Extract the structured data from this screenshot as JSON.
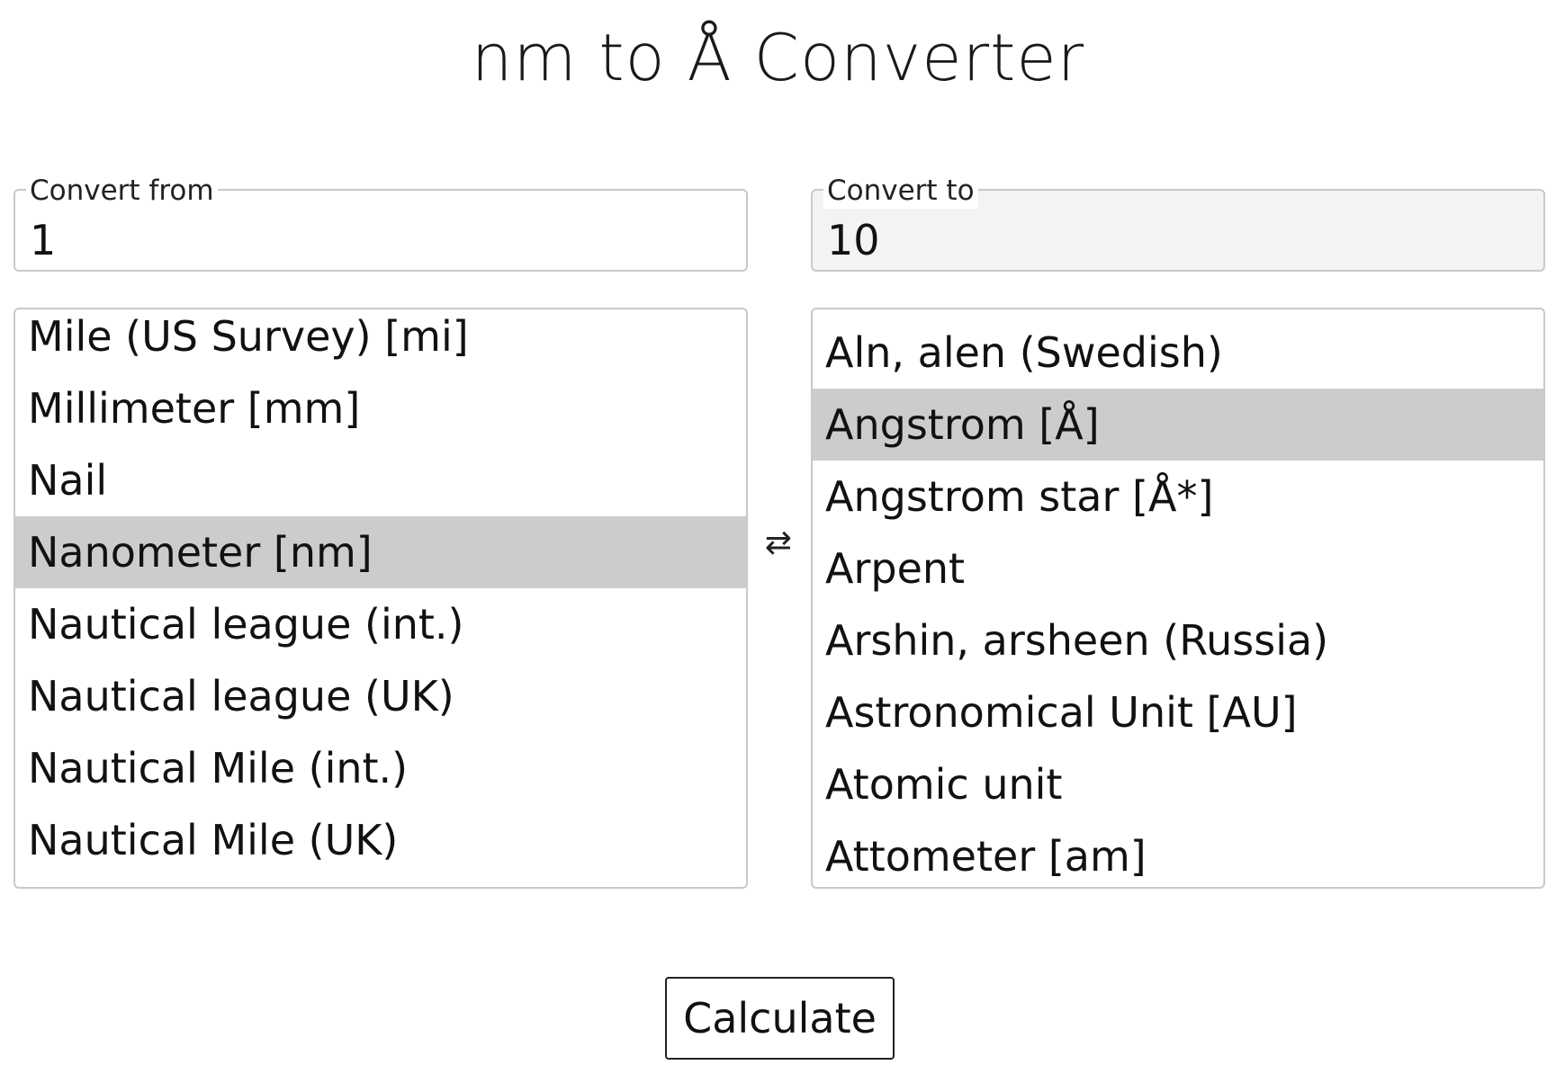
{
  "title": "nm to Å Converter",
  "from": {
    "label": "Convert from",
    "value": "1",
    "units": [
      "Mile (US Survey) [mi]",
      "Millimeter [mm]",
      "Nail",
      "Nanometer [nm]",
      "Nautical league (int.)",
      "Nautical league (UK)",
      "Nautical Mile (int.)",
      "Nautical Mile (UK)"
    ],
    "selected": "Nanometer [nm]"
  },
  "to": {
    "label": "Convert to",
    "value": "10",
    "units": [
      "Aln, alen (Swedish)",
      "Angstrom [Å]",
      "Angstrom star [Å*]",
      "Arpent",
      "Arshin, arsheen (Russia)",
      "Astronomical Unit [AU]",
      "Atomic unit",
      "Attometer [am]"
    ],
    "selected": "Angstrom [Å]"
  },
  "swap_icon": "⇄",
  "calculate_label": "Calculate",
  "colors": {
    "selected_row": "#cccccc",
    "readonly_field": "#f3f3f3",
    "border": "#c9c9c9"
  }
}
